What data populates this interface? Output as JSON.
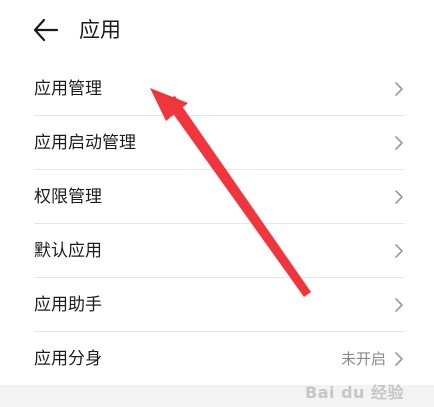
{
  "header": {
    "title": "应用",
    "back_icon": "arrow-left-icon"
  },
  "menu": {
    "items": [
      {
        "label": "应用管理",
        "value": ""
      },
      {
        "label": "应用启动管理",
        "value": ""
      },
      {
        "label": "权限管理",
        "value": ""
      },
      {
        "label": "默认应用",
        "value": ""
      },
      {
        "label": "应用助手",
        "value": ""
      },
      {
        "label": "应用分身",
        "value": "未开启"
      }
    ]
  },
  "watermark": {
    "text": "Bai du 经验"
  },
  "annotation": {
    "color": "#f0363c",
    "icon": "red-annotation-arrow"
  },
  "colors": {
    "text": "#1c1c1c",
    "secondary": "#8a8a8a",
    "divider": "#e6e6e6"
  }
}
